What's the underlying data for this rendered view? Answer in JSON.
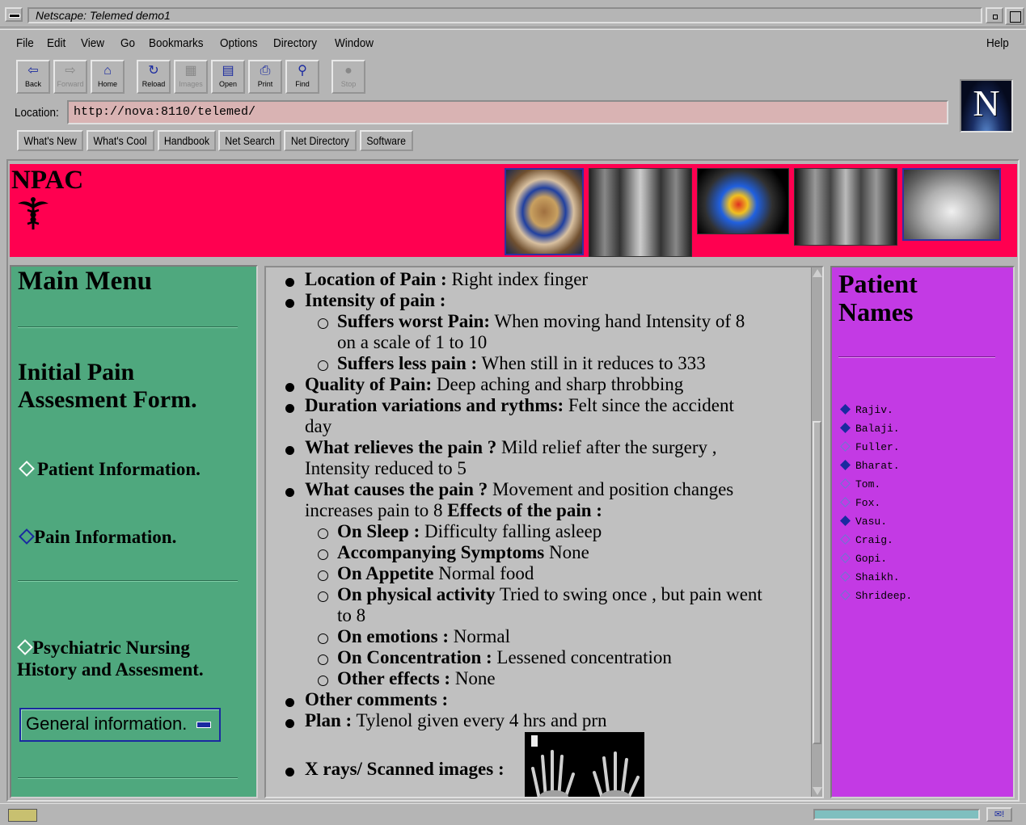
{
  "window": {
    "title": "Netscape: Telemed demo1"
  },
  "menu": {
    "items": [
      "File",
      "Edit",
      "View",
      "Go",
      "Bookmarks",
      "Options",
      "Directory",
      "Window"
    ],
    "help": "Help"
  },
  "toolbar": {
    "buttons": [
      {
        "label": "Back",
        "icon": "back-arrow-icon",
        "glyph": "⇦"
      },
      {
        "label": "Forward",
        "icon": "forward-arrow-icon",
        "glyph": "⇨"
      },
      {
        "label": "Home",
        "icon": "home-icon",
        "glyph": "⌂"
      },
      {
        "label": "Reload",
        "icon": "reload-icon",
        "glyph": "↻"
      },
      {
        "label": "Images",
        "icon": "images-icon",
        "glyph": "▦"
      },
      {
        "label": "Open",
        "icon": "open-icon",
        "glyph": "▤"
      },
      {
        "label": "Print",
        "icon": "print-icon",
        "glyph": "⎙"
      },
      {
        "label": "Find",
        "icon": "find-icon",
        "glyph": "⚲"
      },
      {
        "label": "Stop",
        "icon": "stop-icon",
        "glyph": "●"
      }
    ]
  },
  "location": {
    "label": "Location:",
    "url": "http://nova:8110/telemed/"
  },
  "directory_buttons": [
    "What's New",
    "What's Cool",
    "Handbook",
    "Net Search",
    "Net Directory",
    "Software"
  ],
  "banner": {
    "title": "NPAC"
  },
  "left": {
    "main_menu": "Main Menu",
    "form_title_1": "Initial Pain",
    "form_title_2": "Assesment Form.",
    "link_patient": "Patient Information.",
    "link_pain": "Pain Information.",
    "link_psych_1": "Psychiatric Nursing",
    "link_psych_2": "History and Assesment.",
    "select_value": "General information."
  },
  "pain": {
    "location_label": "Location of Pain :",
    "location_value": " Right index finger",
    "intensity_label": "Intensity of pain :",
    "worst_label": "Suffers worst Pain:",
    "worst_value_1": " When moving hand Intensity of 8",
    "worst_value_2": "on a scale of 1 to 10",
    "less_label": "Suffers less pain :",
    "less_value": " When still in it reduces to 333",
    "quality_label": "Quality of Pain:",
    "quality_value": " Deep aching and sharp throbbing",
    "duration_label": "Duration variations and rythms:",
    "duration_value_1": " Felt since the accident",
    "duration_value_2": "day",
    "relieves_label": "What relieves the pain ?",
    "relieves_value_1": " Mild relief after the surgery ,",
    "relieves_value_2": "Intensity reduced to 5",
    "causes_label": "What causes the pain ?",
    "causes_value_1": " Movement and position changes",
    "causes_value_2": "increases pain to 8 ",
    "effects_label": "Effects of the pain :",
    "sleep_label": "On Sleep :",
    "sleep_value": " Difficulty falling asleep",
    "symptoms_label": "Accompanying Symptoms",
    "symptoms_value": " None",
    "appetite_label": "On Appetite",
    "appetite_value": " Normal food",
    "activity_label": "On physical activity",
    "activity_value_1": " Tried to swing once , but pain went",
    "activity_value_2": "to 8",
    "emotions_label": "On emotions :",
    "emotions_value": " Normal",
    "concentration_label": "On Concentration :",
    "concentration_value": " Lessened concentration",
    "other_effects_label": "Other effects :",
    "other_effects_value": " None",
    "comments_label": "Other comments :",
    "plan_label": "Plan :",
    "plan_value": " Tylenol given every 4 hrs and prn",
    "xrays_label": "X rays/ Scanned images :"
  },
  "right": {
    "title_1": "Patient",
    "title_2": "Names",
    "patients": [
      "Rajiv.",
      "Balaji.",
      "Fuller.",
      "Bharat.",
      "Tom.",
      "Fox.",
      "Vasu.",
      "Craig.",
      "Gopi.",
      "Shaikh.",
      "Shrideep."
    ],
    "visited": [
      true,
      true,
      false,
      true,
      false,
      false,
      true,
      false,
      false,
      false,
      false
    ]
  },
  "colors": {
    "banner": "#ff0050",
    "left_frame": "#4fa87e",
    "right_frame": "#c33ae4",
    "location_field": "#d9b3b3"
  }
}
